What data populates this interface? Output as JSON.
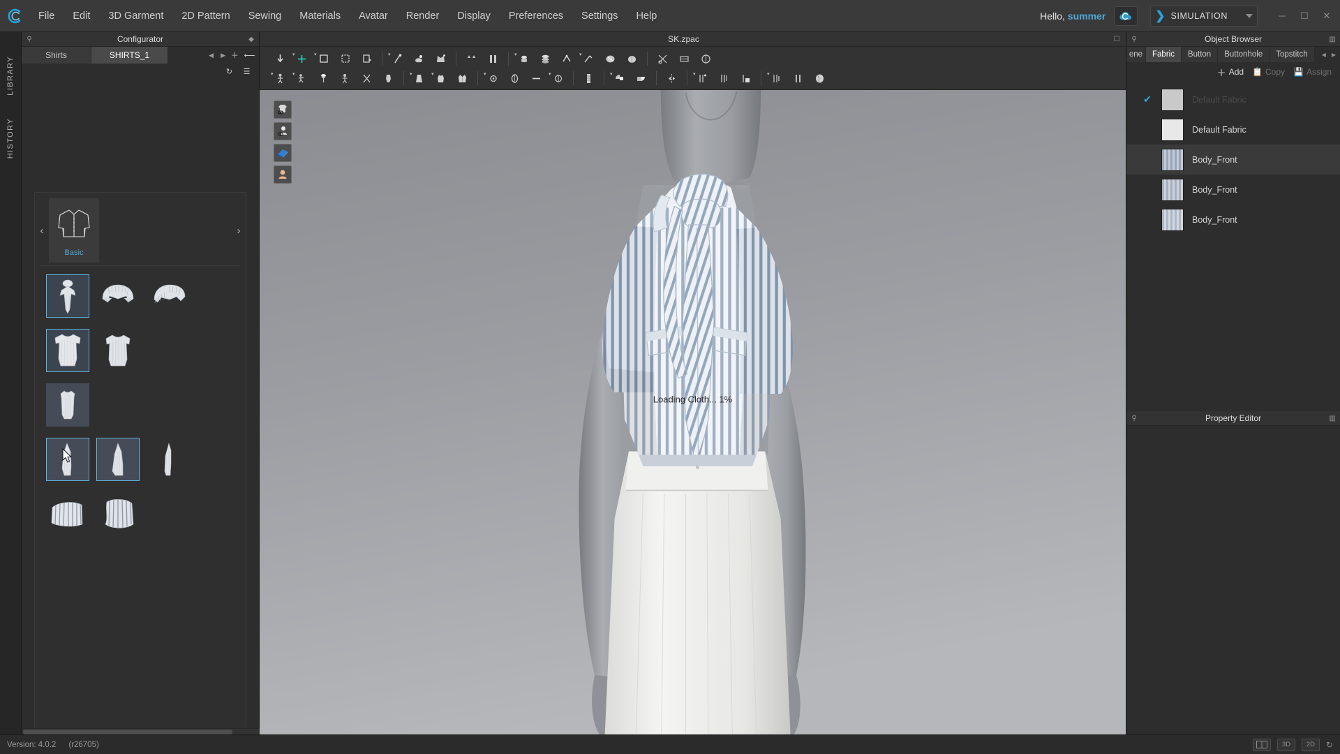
{
  "app": {
    "logo": "clo-logo-icon",
    "menu": [
      "File",
      "Edit",
      "3D Garment",
      "2D Pattern",
      "Sewing",
      "Materials",
      "Avatar",
      "Render",
      "Display",
      "Preferences",
      "Settings",
      "Help"
    ],
    "greeting_prefix": "Hello, ",
    "user": "summer",
    "cloud_icon": "cloud-sync-icon",
    "simulation_label": "SIMULATION",
    "window_controls": [
      "minimize",
      "maximize",
      "close"
    ]
  },
  "rail": {
    "tabs": [
      "LIBRARY",
      "HISTORY"
    ]
  },
  "configurator": {
    "title": "Configurator",
    "pin_icon": "pin-icon",
    "dock_icon": "dock-icon",
    "tabs": [
      {
        "label": "Shirts",
        "active": false
      },
      {
        "label": "SHIRTS_1",
        "active": true
      }
    ],
    "nav_prev": "◀",
    "nav_next": "▶",
    "add_icon": "add-icon",
    "back_icon": "back-arrow-icon",
    "refresh_icon": "refresh-icon",
    "list_icon": "list-icon",
    "category": {
      "name": "Basic",
      "thumb": "shirt-lineart-icon",
      "prev_arrow": "‹",
      "next_arrow": "›"
    },
    "thumb_rows": [
      {
        "name": "collar-row",
        "items": [
          {
            "id": "bow-tie-collar",
            "selected": true,
            "shaded": false,
            "kind": "bow"
          },
          {
            "id": "flat-collar",
            "selected": false,
            "shaded": false,
            "kind": "collar"
          },
          {
            "id": "ruffle-collar",
            "selected": false,
            "shaded": false,
            "kind": "ruffle"
          }
        ]
      },
      {
        "name": "body-row",
        "items": [
          {
            "id": "body-fitted",
            "selected": true,
            "shaded": false,
            "kind": "body"
          },
          {
            "id": "body-relaxed",
            "selected": false,
            "shaded": false,
            "kind": "body2"
          }
        ]
      },
      {
        "name": "body-row-2",
        "items": [
          {
            "id": "body-slim",
            "selected": false,
            "shaded": true,
            "kind": "body3"
          }
        ]
      },
      {
        "name": "sleeve-row",
        "items": [
          {
            "id": "sleeve-short",
            "selected": true,
            "shaded": true,
            "kind": "sleeve",
            "cursor": true
          },
          {
            "id": "sleeve-medium",
            "selected": true,
            "shaded": true,
            "kind": "sleeve2"
          },
          {
            "id": "sleeve-long",
            "selected": false,
            "shaded": false,
            "kind": "sleeve3"
          }
        ]
      },
      {
        "name": "cuff-row",
        "items": [
          {
            "id": "cuff-straight",
            "selected": false,
            "shaded": false,
            "kind": "cuff"
          },
          {
            "id": "cuff-flared",
            "selected": false,
            "shaded": false,
            "kind": "cuff2"
          }
        ]
      }
    ]
  },
  "viewport": {
    "title": "SK.zpac",
    "dock_icon": "dock-icon",
    "loading_text": "Loading Cloth... 1%",
    "overlay_tools": [
      {
        "name": "show-garment-toggle",
        "icon": "garment-eye-icon"
      },
      {
        "name": "show-avatar-toggle",
        "icon": "avatar-eye-icon"
      },
      {
        "name": "fabric-library-toggle",
        "icon": "blue-book-icon"
      },
      {
        "name": "skin-toggle",
        "icon": "skin-head-icon"
      }
    ],
    "toolbar_row1": [
      "select-mesh-tool",
      "transform-garment-tool",
      "select-pattern-tool",
      "edit-pattern-tool",
      "copy-pattern-tool",
      "pin-tool",
      "tape-measure-tool",
      "fold-arrange-tool",
      "garment-fit-tool",
      "zipper-tool",
      "button-tool",
      "buttonhole-tool",
      "topstitch-tool",
      "stitch-line-tool",
      "fabric-puckering-tool",
      "gather-tool",
      "trim-tool",
      "grading-tool",
      "arrange-tool"
    ],
    "toolbar_row2": [
      "avatar-move-tool",
      "avatar-pose-tool",
      "avatar-hair-tool",
      "avatar-edit-tool",
      "avatar-measure-tool",
      "mannequin-tool",
      "skirt-tool",
      "dress-tool",
      "vest-tool",
      "circle-select-tool",
      "ellipse-tool",
      "line-tool",
      "point-tool",
      "tape-roll-tool",
      "light-left-tool",
      "light-right-tool",
      "mirror-tool",
      "pattern-symmetric-tool",
      "pattern-flip-tool",
      "pattern-attach-tool",
      "pattern-layer-tool",
      "pattern-pair-tool",
      "render-preview-tool"
    ]
  },
  "object_browser": {
    "title": "Object Browser",
    "pin_icon": "pin-icon",
    "dock_icon": "dock-icon",
    "tabs": [
      {
        "label": "ene",
        "active": false,
        "partial": true
      },
      {
        "label": "Fabric",
        "active": true,
        "partial": false
      },
      {
        "label": "Button",
        "active": false,
        "partial": false
      },
      {
        "label": "Buttonhole",
        "active": false,
        "partial": false
      },
      {
        "label": "Topstitch",
        "active": false,
        "partial": false
      }
    ],
    "actions": [
      {
        "label": "Add",
        "icon": "plus-icon",
        "enabled": true
      },
      {
        "label": "Copy",
        "icon": "copy-icon",
        "enabled": false
      },
      {
        "label": "Assign",
        "icon": "assign-icon",
        "enabled": false
      }
    ],
    "rows": [
      {
        "label": "Default Fabric",
        "checked": true,
        "dim": true,
        "swatch": "#c9c9c9",
        "highlight": false
      },
      {
        "label": "Default Fabric",
        "checked": false,
        "dim": false,
        "swatch": "#e8e8e8",
        "highlight": false
      },
      {
        "label": "Body_Front",
        "checked": false,
        "dim": false,
        "swatch": "#a3aab8",
        "highlight": true
      },
      {
        "label": "Body_Front",
        "checked": false,
        "dim": false,
        "swatch": "#aeb4c0",
        "highlight": false
      },
      {
        "label": "Body_Front",
        "checked": false,
        "dim": false,
        "swatch": "#b4bac4",
        "highlight": false
      }
    ]
  },
  "property_editor": {
    "title": "Property Editor",
    "pin_icon": "pin-icon",
    "dock_icon": "dock-icon"
  },
  "status": {
    "version_label": "Version: 4.0.2",
    "revision": "(r26705)",
    "buttons": [
      {
        "name": "split-view-button",
        "label": "",
        "icon": "split-view-icon"
      },
      {
        "name": "view-3d-button",
        "label": "3D"
      },
      {
        "name": "view-2d-button",
        "label": "2D"
      }
    ],
    "reset_icon": "reset-icon"
  },
  "colors": {
    "accent": "#29a3dd",
    "panel": "#2d2d2d",
    "menubar": "#3a3a3a",
    "selection_border": "#5fb4dd"
  }
}
